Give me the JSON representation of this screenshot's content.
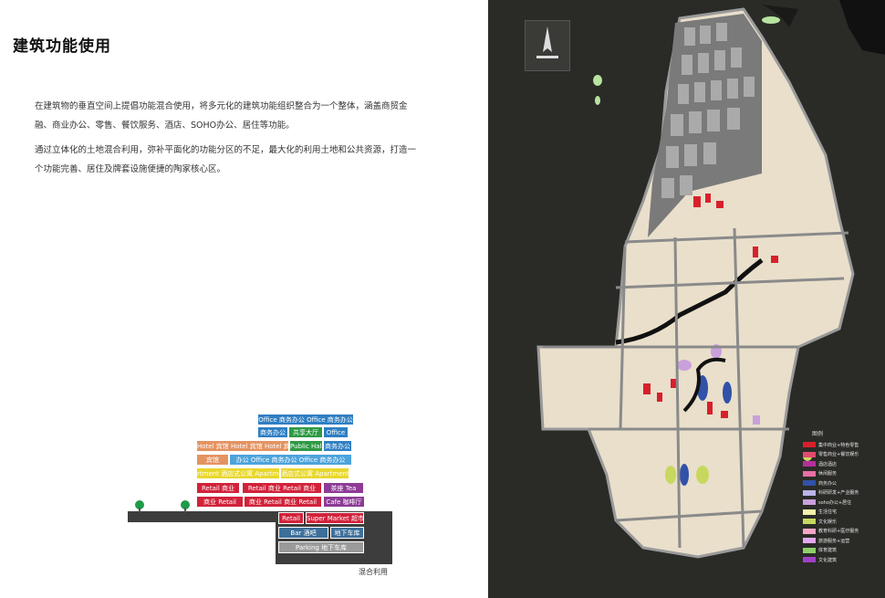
{
  "page": {
    "title": "建筑功能使用",
    "paragraph1": "在建筑物的垂直空间上提倡功能混合使用，将多元化的建筑功能组织整合为一个整体，涵盖商贸金融、商业办公、零售、餐饮服务、酒店、SOHO办公、居住等功能。",
    "paragraph2": "通过立体化的土地混合利用，弥补平面化的功能分区的不足，最大化的利用土地和公共资源，打造一个功能完善、居住及牌套设施便捷的陶家核心区。"
  },
  "diagram": {
    "caption": "混合利用",
    "rows": [
      {
        "blocks": [
          {
            "text": "Office 商务办公 Office 商务办公",
            "color": "blue"
          }
        ]
      },
      {
        "blocks": [
          {
            "text": "商务办公",
            "color": "blue"
          },
          {
            "text": "共享大厅",
            "color": "green"
          },
          {
            "text": "Office",
            "color": "blue"
          }
        ]
      },
      {
        "blocks": [
          {
            "text": "Hotel 宾馆 Hotel 宾馆 Hotel 宾馆",
            "color": "orange"
          },
          {
            "text": "Public Hall",
            "color": "green"
          },
          {
            "text": "商务办公",
            "color": "blue"
          }
        ]
      },
      {
        "blocks": [
          {
            "text": "宾馆",
            "color": "orange"
          },
          {
            "text": "办公 Office 商务办公 Office 商务办公",
            "color": "lightblue"
          }
        ]
      },
      {
        "blocks": [
          {
            "text": "rtment 酒店式公寓 Apartment",
            "color": "yellow"
          },
          {
            "text": "酒店式公寓 Apartment",
            "color": "yellow"
          }
        ]
      },
      {
        "blocks": [
          {
            "text": "Retail 商业",
            "color": "red"
          },
          {
            "text": "Retail 商业 Retail 商业",
            "color": "red"
          },
          {
            "text": "茶座 Tea",
            "color": "purple"
          }
        ]
      },
      {
        "blocks": [
          {
            "text": "商业 Retail",
            "color": "red"
          },
          {
            "text": "商业 Retail 商业 Retail",
            "color": "red"
          },
          {
            "text": "Cafe 咖啡厅",
            "color": "purple"
          }
        ]
      },
      {
        "blocks": [
          {
            "text": "Retail",
            "color": "red"
          },
          {
            "text": "Super Market 超市",
            "color": "red"
          }
        ]
      },
      {
        "blocks": [
          {
            "text": "Bar 酒吧",
            "color": "steel"
          },
          {
            "text": "地下车库",
            "color": "steel"
          }
        ]
      },
      {
        "blocks": [
          {
            "text": "Parking 地下车库",
            "color": "grey"
          }
        ]
      }
    ]
  },
  "legend": {
    "title": "图例",
    "items": [
      {
        "label": "集中商业+特色零售",
        "color": "#d8202c"
      },
      {
        "label": "零售商业+餐饮娱乐",
        "color": "#e34a6e"
      },
      {
        "label": "酒店酒店",
        "color": "#b3309a"
      },
      {
        "label": "休闲服务",
        "color": "#e86ea3"
      },
      {
        "label": "商务办公",
        "color": "#3152a8"
      },
      {
        "label": "科研研发+产业服务",
        "color": "#b9b5e8"
      },
      {
        "label": "soho办公+居住",
        "color": "#c9a0dc"
      },
      {
        "label": "生活住宅",
        "color": "#f3f1a8"
      },
      {
        "label": "文化娱乐",
        "color": "#c8d85e"
      },
      {
        "label": "教育科研+医疗服务",
        "color": "#f5a6c8"
      },
      {
        "label": "旅游服务+运营",
        "color": "#e2a8f0"
      },
      {
        "label": "体育建筑",
        "color": "#8fd06b"
      },
      {
        "label": "文化建筑",
        "color": "#a040c8"
      }
    ]
  },
  "colors": {
    "map_background": "#2a2b27",
    "road": "#8a8a8a",
    "residential": "#f3e9d3"
  }
}
